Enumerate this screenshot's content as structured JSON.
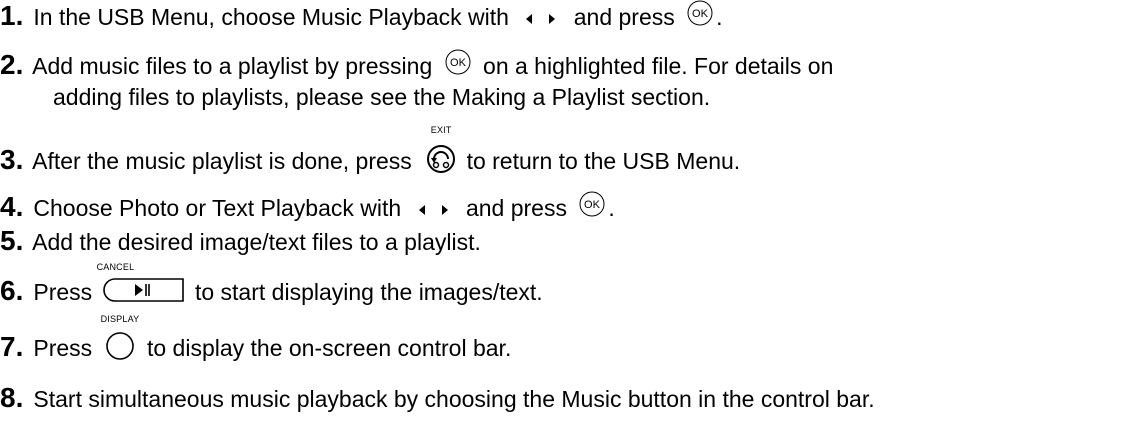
{
  "steps": [
    {
      "num": "1.",
      "a": "In the USB Menu, choose Music Playback with",
      "b": "and press",
      "end": "."
    },
    {
      "num": "2.",
      "a": "Add music files to a playlist by pressing",
      "b": "on a highlighted file. For details on",
      "c": "adding files to playlists, please see the Making a Playlist section."
    },
    {
      "num": "3.",
      "a": "After the music playlist is done, press",
      "b": "to return to the USB Menu."
    },
    {
      "num": "4.",
      "a": "Choose Photo or Text Playback with",
      "b": "and press",
      "end": "."
    },
    {
      "num": "5.",
      "a": "Add the desired image/text files to a playlist."
    },
    {
      "num": "6.",
      "a": "Press",
      "b": "to start displaying the images/text."
    },
    {
      "num": "7.",
      "a": "Press",
      "b": "to display the on-screen control bar."
    },
    {
      "num": "8.",
      "a": "Start simultaneous music playback by choosing the Music button in the control bar."
    }
  ],
  "icons": {
    "ok": "OK",
    "exit": "EXIT",
    "cancel": "CANCEL",
    "display": "DISPLAY"
  }
}
